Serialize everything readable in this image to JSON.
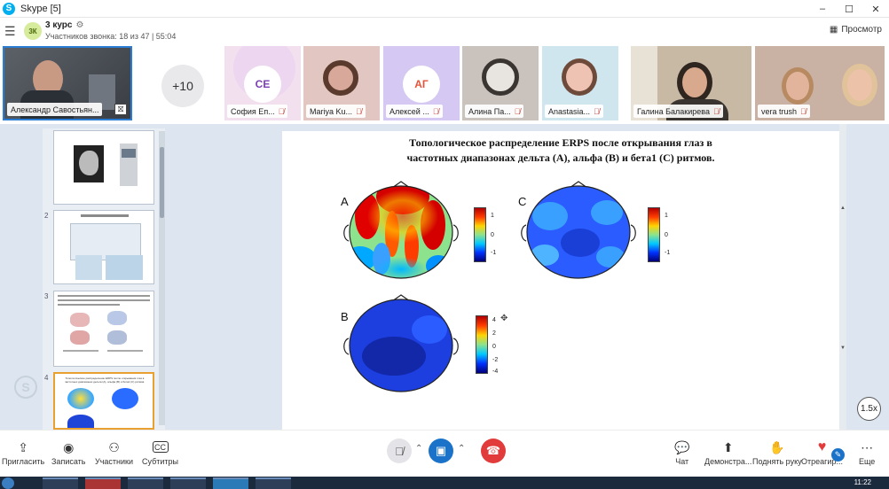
{
  "window": {
    "title": "Skype [5]",
    "app_icon": "skype-icon",
    "controls": [
      "–",
      "☐",
      "✕"
    ]
  },
  "call": {
    "group_initials": "3К",
    "name": "3 курс",
    "participants_label": "Участников звонка: 18 из 47 | 55:04",
    "view_button": "Просмотр"
  },
  "participants": {
    "self": {
      "name": "Александр Савостьян..."
    },
    "overflow": "+10",
    "tiles": [
      {
        "name": "София Еп...",
        "initials": "СЕ",
        "bg": "#f3e0ef",
        "circle_color": "#7b3fb5"
      },
      {
        "name": "Mariya Ku..."
      },
      {
        "name": "Алексей ...",
        "initials": "АГ",
        "bg": "#d5c8f2",
        "circle_color": "#e5533a"
      },
      {
        "name": "Алина Па..."
      },
      {
        "name": "Anastasia..."
      },
      {
        "name": "Галина Балакирева"
      },
      {
        "name": "vera trush"
      }
    ]
  },
  "slide": {
    "title_line1": "Топологическое распределение ERPS после открывания глаз в",
    "title_line2": "частотных диапазонах дельта (А), альфа (В) и бета1 (С) ритмов.",
    "label_a": "A",
    "label_b": "B",
    "label_c": "C",
    "cb_a": [
      "1",
      "0",
      "-1"
    ],
    "cb_c": [
      "1",
      "0",
      "-1"
    ],
    "cb_b": [
      "4",
      "2",
      "0",
      "-2",
      "-4"
    ],
    "thumb4_text": "Топологическое распределение ERPS после открывания глаз в частотных диапазонах дельта (А), альфа (В) и бета1 (С) ритмов."
  },
  "zoom": "1.5x",
  "controls": {
    "invite": "Пригласить",
    "record": "Записать",
    "participants": "Участники",
    "subtitles": "Субтитры",
    "chat": "Чат",
    "share": "Демонстра...",
    "raise_hand": "Поднять руку",
    "react": "Отреагир...",
    "more": "Еще"
  },
  "taskbar": {
    "clock": "11:22"
  }
}
